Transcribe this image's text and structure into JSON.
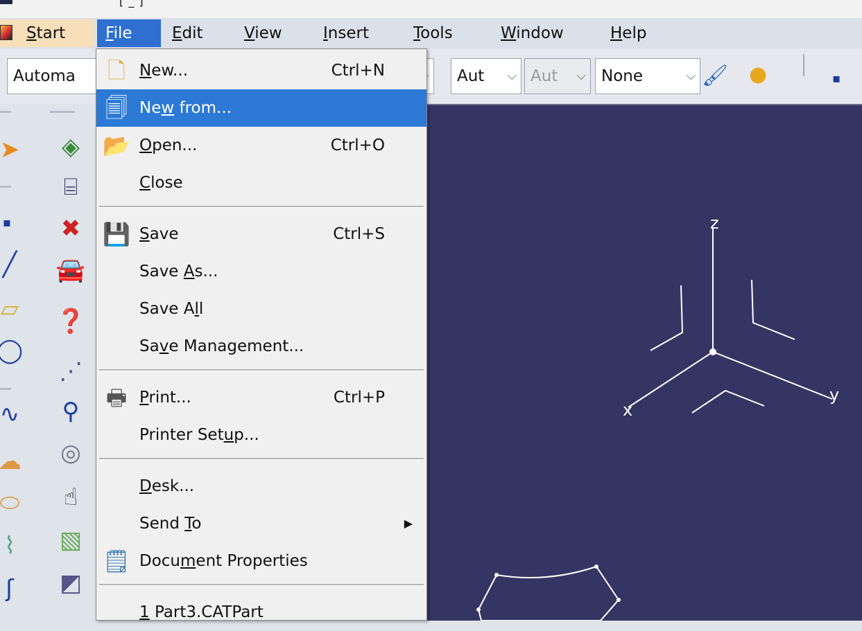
{
  "title": {
    "fragment": "[ _ ]"
  },
  "menubar": {
    "items": [
      {
        "label_mnemonic": "S",
        "label_rest": "tart"
      },
      {
        "label_mnemonic": "F",
        "label_rest": "ile"
      },
      {
        "label_mnemonic": "E",
        "label_rest": "dit"
      },
      {
        "label_mnemonic": "V",
        "label_rest": "iew"
      },
      {
        "label_mnemonic": "I",
        "label_rest": "nsert"
      },
      {
        "label_mnemonic": "T",
        "label_rest": "ools"
      },
      {
        "label_mnemonic": "W",
        "label_rest": "indow"
      },
      {
        "label_mnemonic": "H",
        "label_rest": "elp"
      }
    ]
  },
  "toolbar": {
    "combo_1": "Automa",
    "combo_2": "Aut",
    "combo_3": "Aut",
    "combo_4": "None"
  },
  "file_menu": {
    "new": {
      "pre": "",
      "mn": "N",
      "post": "ew...",
      "shortcut": "Ctrl+N"
    },
    "new_from": {
      "pre": "Ne",
      "mn": "w",
      "post": " from..."
    },
    "open": {
      "pre": "",
      "mn": "O",
      "post": "pen...",
      "shortcut": "Ctrl+O"
    },
    "close": {
      "pre": "",
      "mn": "C",
      "post": "lose"
    },
    "save": {
      "pre": "",
      "mn": "S",
      "post": "ave",
      "shortcut": "Ctrl+S"
    },
    "save_as": {
      "pre": "Save ",
      "mn": "A",
      "post": "s..."
    },
    "save_all": {
      "pre": "Save A",
      "mn": "l",
      "post": "l"
    },
    "save_management": {
      "pre": "Sa",
      "mn": "v",
      "post": "e Management..."
    },
    "print": {
      "pre": "",
      "mn": "P",
      "post": "rint...",
      "shortcut": "Ctrl+P"
    },
    "printer_setup": {
      "pre": "Printer Set",
      "mn": "u",
      "post": "p..."
    },
    "desk": {
      "pre": "",
      "mn": "D",
      "post": "esk..."
    },
    "send_to": {
      "pre": "Send ",
      "mn": "T",
      "post": "o"
    },
    "document_properties": {
      "pre": "Docu",
      "mn": "m",
      "post": "ent Properties"
    },
    "recent_1": {
      "pre": "",
      "mn": "1",
      "post": " Part3.CATPart"
    }
  },
  "viewport": {
    "axis_z": "z",
    "axis_x": "x",
    "axis_y": "y"
  },
  "colors": {
    "viewport_bg": "#353564",
    "selection": "#2c79d6",
    "menu_active": "#2f6fd0",
    "start_bg": "#f6dfb9"
  }
}
